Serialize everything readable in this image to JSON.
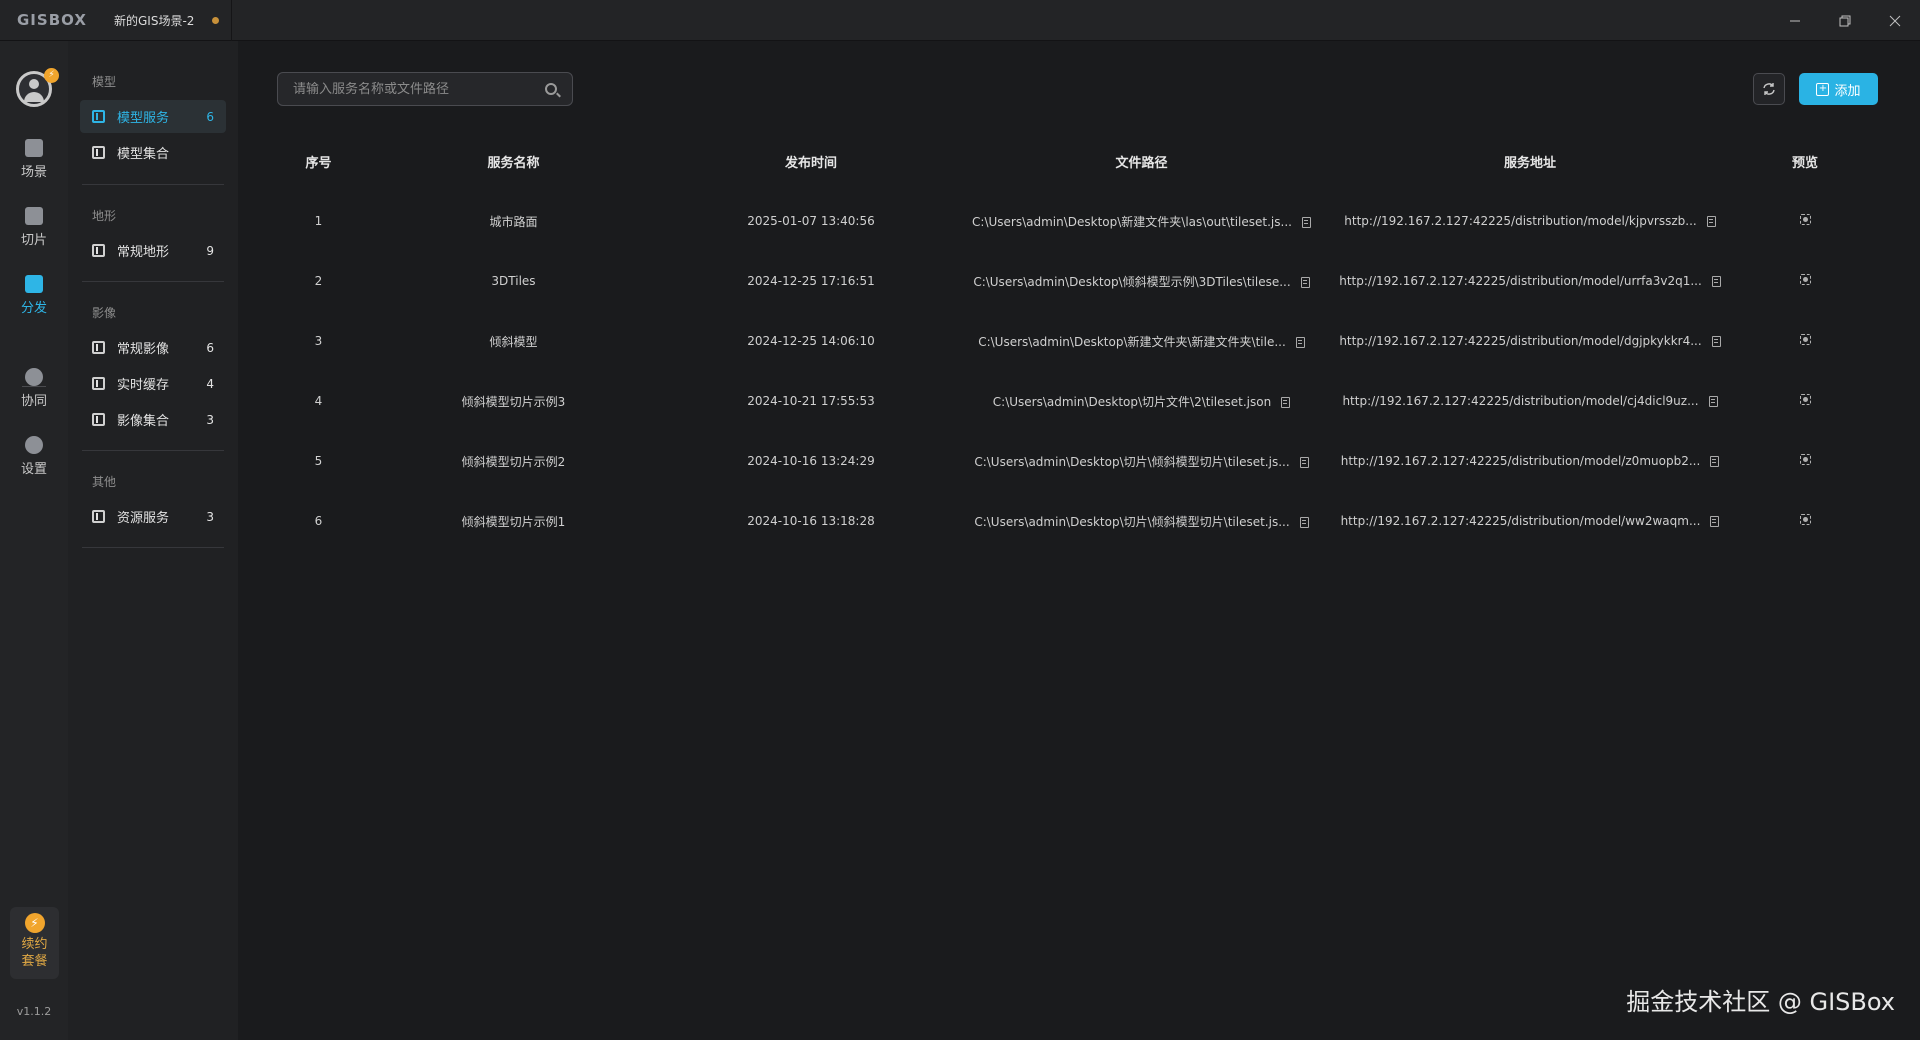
{
  "titlebar": {
    "logo": "GISBOX",
    "tab_name": "新的GIS场景-2"
  },
  "rail": {
    "items": [
      {
        "label": "场景",
        "icon": "home-icon"
      },
      {
        "label": "切片",
        "icon": "slice-icon"
      },
      {
        "label": "分发",
        "icon": "distribute-icon",
        "active": true
      },
      {
        "label": "协同",
        "icon": "lock-icon"
      },
      {
        "label": "设置",
        "icon": "gear-icon"
      }
    ],
    "plan_line1": "续约",
    "plan_line2": "套餐",
    "version": "v1.1.2"
  },
  "categories": {
    "model_head": "模型",
    "terrain_head": "地形",
    "imagery_head": "影像",
    "other_head": "其他",
    "items": [
      {
        "label": "模型服务",
        "count": "6",
        "active": true
      },
      {
        "label": "模型集合",
        "count": ""
      },
      {
        "label": "常规地形",
        "count": "9"
      },
      {
        "label": "常规影像",
        "count": "6"
      },
      {
        "label": "实时缓存",
        "count": "4"
      },
      {
        "label": "影像集合",
        "count": "3"
      },
      {
        "label": "资源服务",
        "count": "3"
      }
    ]
  },
  "search": {
    "placeholder": "请输入服务名称或文件路径"
  },
  "toolbar": {
    "add_label": "添加"
  },
  "table": {
    "headers": [
      "序号",
      "服务名称",
      "发布时间",
      "文件路径",
      "服务地址",
      "预览"
    ],
    "rows": [
      {
        "idx": "1",
        "name": "城市路面",
        "time": "2025-01-07 13:40:56",
        "path": "C:\\Users\\admin\\Desktop\\新建文件夹\\las\\out\\tileset.js...",
        "url": "http://192.167.2.127:42225/distribution/model/kjpvrsszb..."
      },
      {
        "idx": "2",
        "name": "3DTiles",
        "time": "2024-12-25 17:16:51",
        "path": "C:\\Users\\admin\\Desktop\\倾斜模型示例\\3DTiles\\tilese...",
        "url": "http://192.167.2.127:42225/distribution/model/urrfa3v2q1..."
      },
      {
        "idx": "3",
        "name": "倾斜模型",
        "time": "2024-12-25 14:06:10",
        "path": "C:\\Users\\admin\\Desktop\\新建文件夹\\新建文件夹\\tile...",
        "url": "http://192.167.2.127:42225/distribution/model/dgjpkykkr4..."
      },
      {
        "idx": "4",
        "name": "倾斜模型切片示例3",
        "time": "2024-10-21 17:55:53",
        "path": "C:\\Users\\admin\\Desktop\\切片文件\\2\\tileset.json",
        "url": "http://192.167.2.127:42225/distribution/model/cj4dicl9uz..."
      },
      {
        "idx": "5",
        "name": "倾斜模型切片示例2",
        "time": "2024-10-16 13:24:29",
        "path": "C:\\Users\\admin\\Desktop\\切片\\倾斜模型切片\\tileset.js...",
        "url": "http://192.167.2.127:42225/distribution/model/z0muopb2..."
      },
      {
        "idx": "6",
        "name": "倾斜模型切片示例1",
        "time": "2024-10-16 13:18:28",
        "path": "C:\\Users\\admin\\Desktop\\切片\\倾斜模型切片\\tileset.js...",
        "url": "http://192.167.2.127:42225/distribution/model/ww2waqm..."
      }
    ]
  },
  "watermark": "掘金技术社区 @ GISBox"
}
